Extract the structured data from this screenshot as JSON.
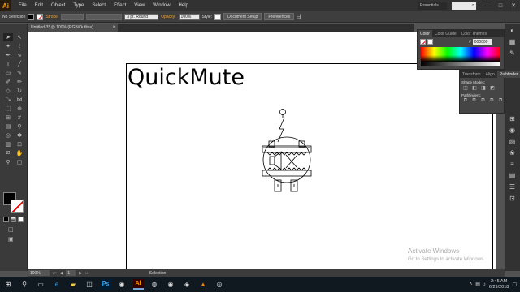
{
  "app": {
    "logo": "Ai",
    "menus": [
      "File",
      "Edit",
      "Object",
      "Type",
      "Select",
      "Effect",
      "View",
      "Window",
      "Help"
    ],
    "workspace": "Essentials",
    "window_buttons": [
      "–",
      "□",
      "✕"
    ]
  },
  "control_bar": {
    "selection_label": "No Selection",
    "stroke_label": "Stroke:",
    "brush_value": "3 pt. Round",
    "opacity_label": "Opacity:",
    "opacity_value": "100%",
    "style_label": "Style:",
    "document_setup": "Document Setup",
    "preferences": "Preferences"
  },
  "document": {
    "tab_title": "Untitled-3* @ 100% (RGB/Outline)",
    "close": "×",
    "headline": "QuickMute"
  },
  "color_panel": {
    "tabs": [
      "Color",
      "Color Guide",
      "Color Themes"
    ],
    "hex_label": "#",
    "hex_value": "000000"
  },
  "pathfinder_panel": {
    "tabs": [
      "Transform",
      "Align",
      "Pathfinder"
    ],
    "shape_modes_label": "Shape Modes:",
    "pathfinders_label": "Pathfinders:"
  },
  "status_bar": {
    "zoom": "100%",
    "page": "1",
    "tool_status": "Selection"
  },
  "watermark": {
    "line1": "Activate Windows",
    "line2": "Go to Settings to activate Windows."
  },
  "taskbar": {
    "time": "2:45 AM",
    "date": "6/29/2018"
  },
  "tools": [
    "selection-tool",
    "direct-selection-tool",
    "magic-wand-tool",
    "lasso-tool",
    "pen-tool",
    "curvature-tool",
    "type-tool",
    "line-tool",
    "rectangle-tool",
    "paintbrush-tool",
    "shaper-tool",
    "pencil-tool",
    "eraser-tool",
    "rotate-tool",
    "scale-tool",
    "width-tool",
    "free-transform-tool",
    "shape-builder-tool",
    "perspective-tool",
    "mesh-tool",
    "gradient-tool",
    "eyedropper-tool",
    "blend-tool",
    "symbol-sprayer-tool",
    "column-graph-tool",
    "artboard-tool",
    "slice-tool",
    "hand-tool",
    "zoom-tool",
    "print-tiling-tool"
  ]
}
